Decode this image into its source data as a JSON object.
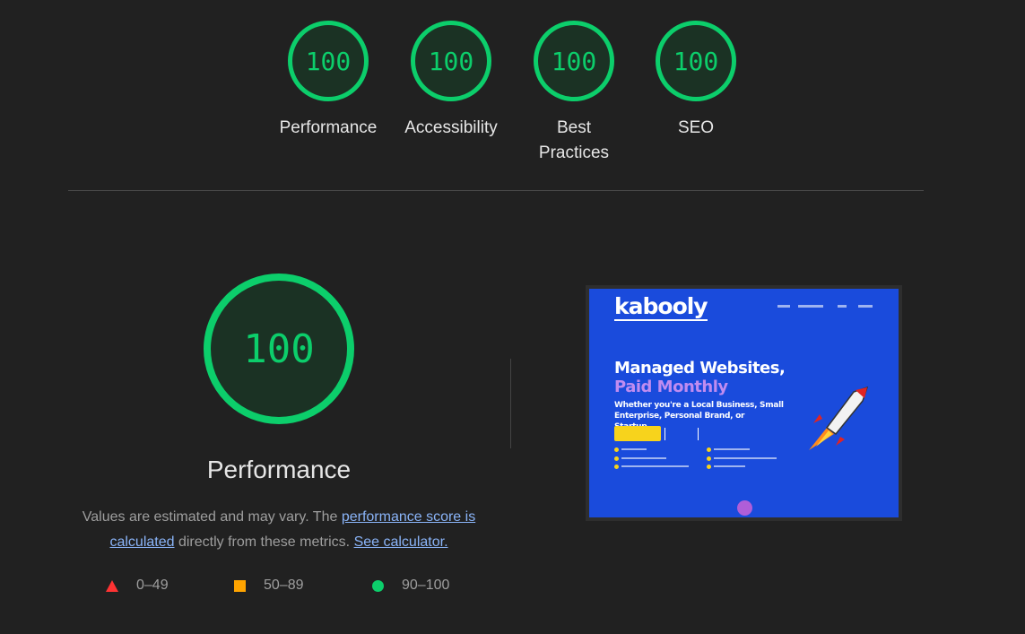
{
  "categories": [
    {
      "label": "Performance",
      "score": "100"
    },
    {
      "label": "Accessibility",
      "score": "100"
    },
    {
      "label": "Best Practices",
      "score": "100"
    },
    {
      "label": "SEO",
      "score": "100"
    }
  ],
  "performance": {
    "score": "100",
    "title": "Performance",
    "desc_prefix": "Values are estimated and may vary. The ",
    "link_score": "performance score is calculated",
    "desc_mid": " directly from these metrics. ",
    "link_calculator": "See calculator."
  },
  "legend": [
    {
      "range": "0–49",
      "shape": "triangle",
      "color": "#ff3333"
    },
    {
      "range": "50–89",
      "shape": "square",
      "color": "#ffa400"
    },
    {
      "range": "90–100",
      "shape": "circle",
      "color": "#0cce6b"
    }
  ],
  "screenshot": {
    "logo": "kabooly",
    "headline_1": "Managed Websites,",
    "headline_2": "Paid Monthly",
    "subtitle": "Whether you're a Local Business, Small Enterprise, Personal Brand, or Startup..."
  },
  "colors": {
    "pass": "#0cce6b",
    "background": "#212121",
    "link": "#8ab4f8"
  }
}
